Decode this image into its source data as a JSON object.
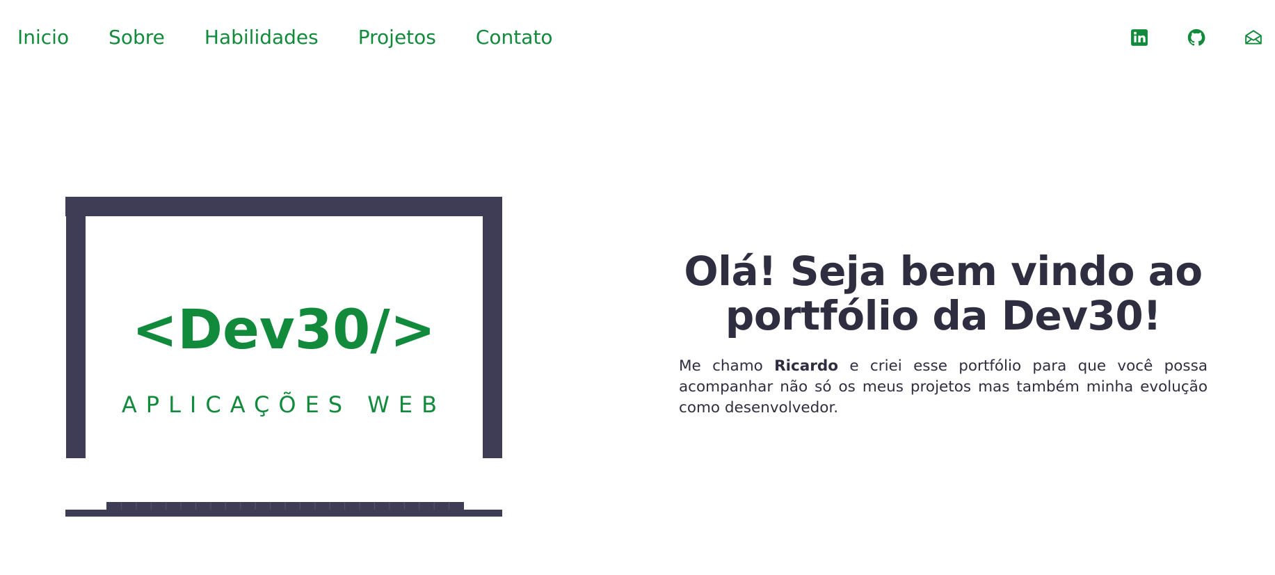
{
  "nav": {
    "items": [
      {
        "label": "Inicio"
      },
      {
        "label": "Sobre"
      },
      {
        "label": "Habilidades"
      },
      {
        "label": "Projetos"
      },
      {
        "label": "Contato"
      }
    ]
  },
  "social": {
    "icons": [
      "linkedin-icon",
      "github-icon",
      "mail-icon"
    ]
  },
  "hero": {
    "logo_text": "<Dev30/>",
    "logo_subtitle": "APLICAÇÕES WEB",
    "title_line1": "Olá! Seja bem vindo ao",
    "title_line2": "portfólio da Dev30!",
    "desc_prefix": "Me chamo ",
    "desc_name": "Ricardo",
    "desc_suffix": " e criei esse portfólio para que você possa acompanhar não só os meus projetos mas também minha evolução como desenvolvedor."
  },
  "colors": {
    "accent": "#118a3c",
    "dark": "#3f3d56",
    "text": "#2f2e41"
  }
}
